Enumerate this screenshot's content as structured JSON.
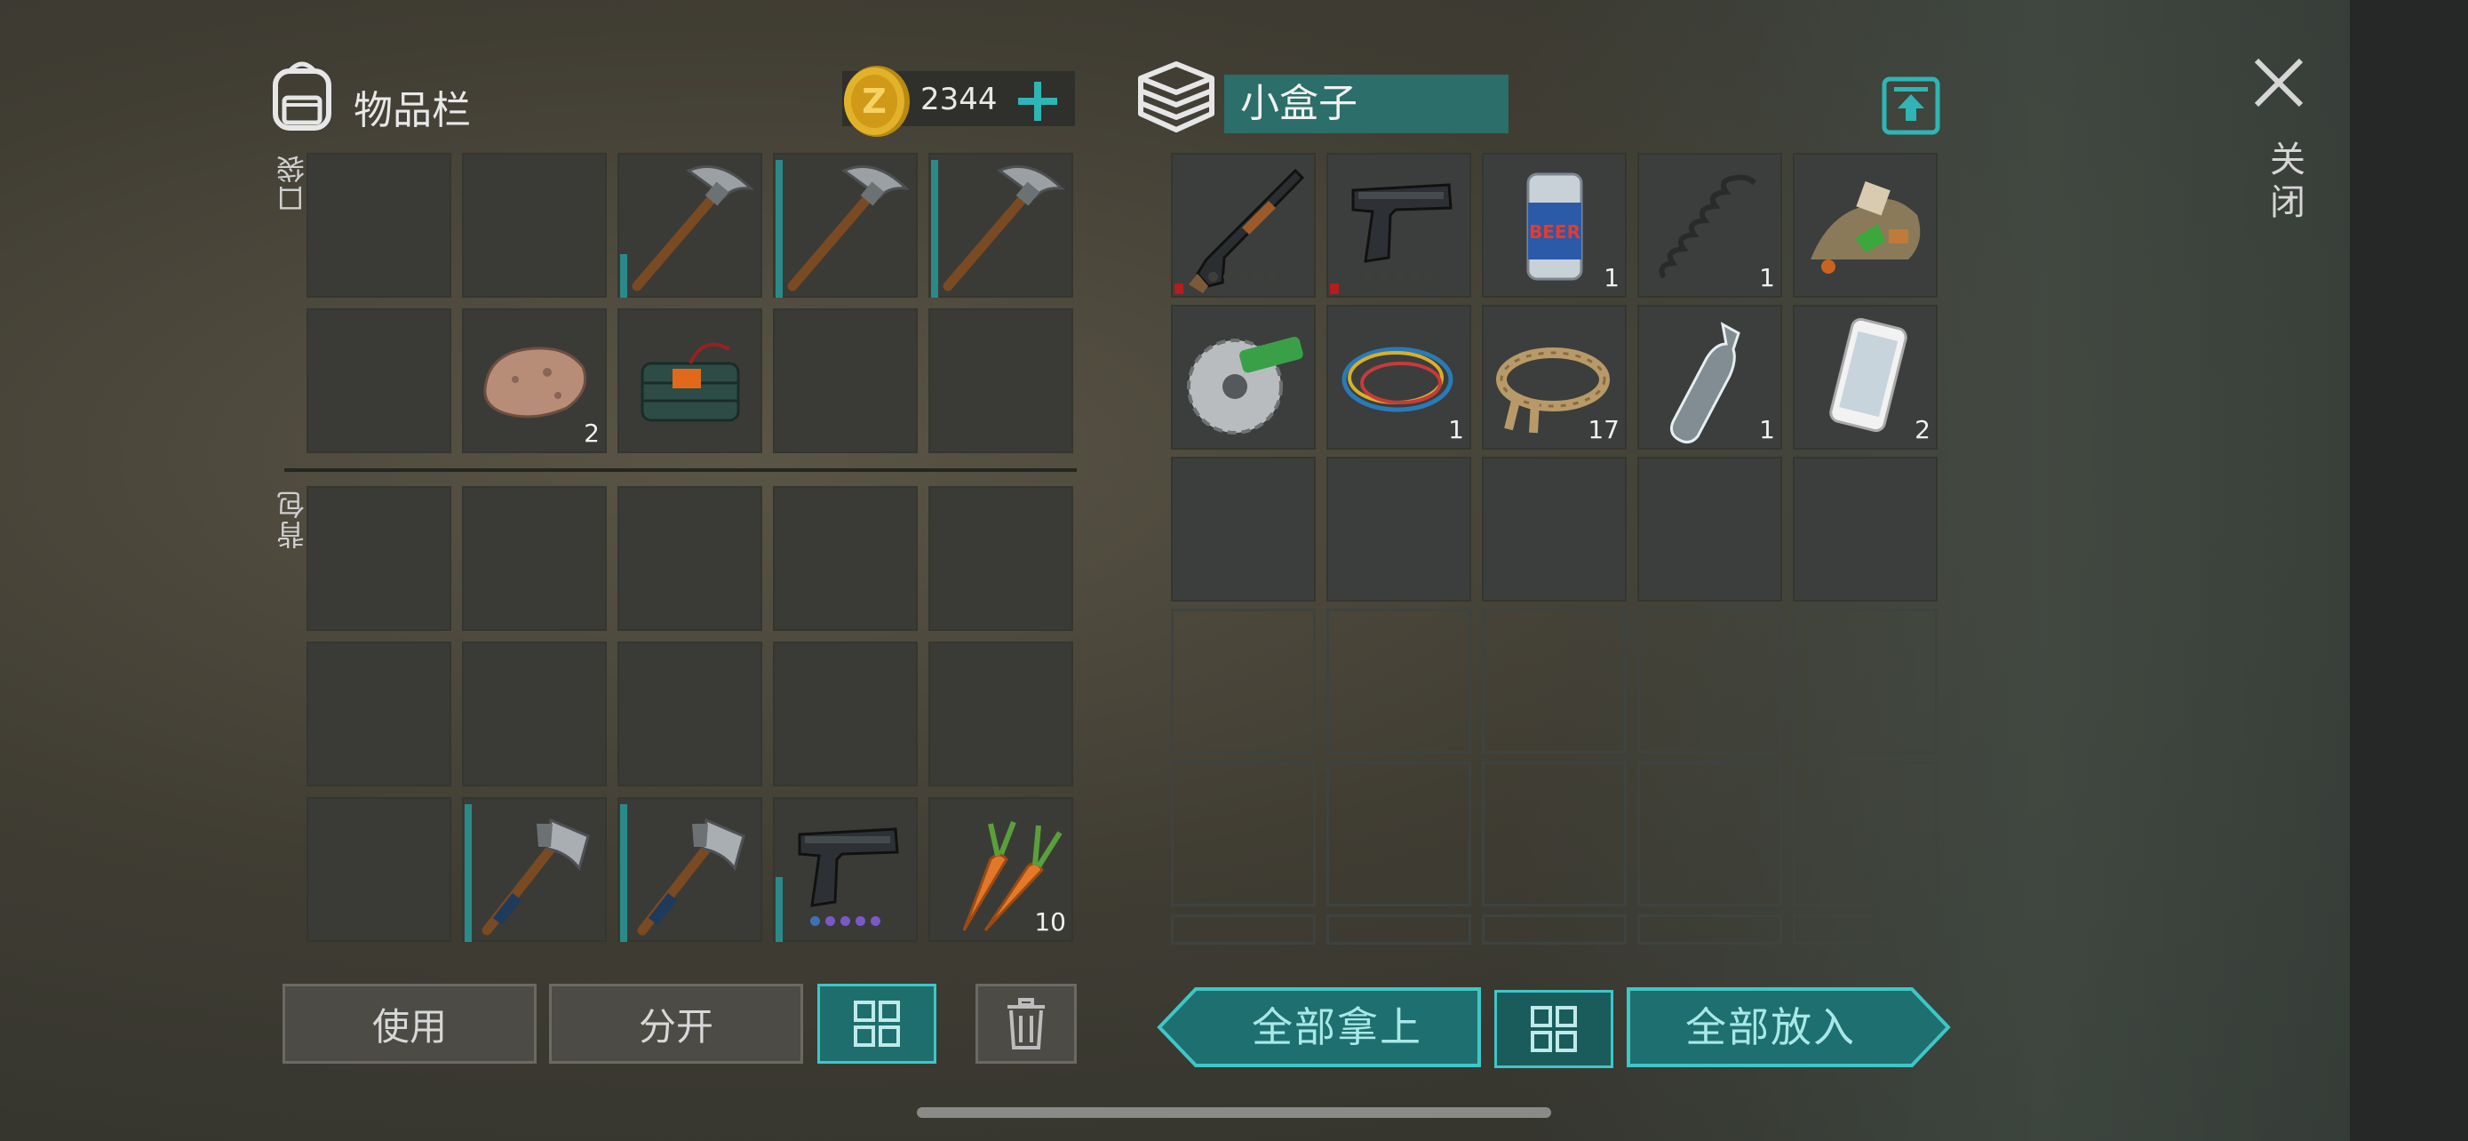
{
  "inventory": {
    "title": "物品栏",
    "coins": "2344",
    "pocket_label": "口袋",
    "backpack_label": "背包",
    "pocket_rows": [
      [
        {
          "item": ""
        },
        {
          "item": ""
        },
        {
          "item": "pickaxe-icon",
          "durability": 0.3
        },
        {
          "item": "pickaxe-icon",
          "durability": 0.95
        },
        {
          "item": "pickaxe-icon",
          "durability": 0.95
        }
      ],
      [
        {
          "item": ""
        },
        {
          "item": "stone-icon",
          "count": "2"
        },
        {
          "item": "explosive-icon"
        },
        {
          "item": ""
        },
        {
          "item": ""
        }
      ]
    ],
    "backpack_rows": [
      [
        {
          "item": ""
        },
        {
          "item": ""
        },
        {
          "item": ""
        },
        {
          "item": ""
        },
        {
          "item": ""
        }
      ],
      [
        {
          "item": ""
        },
        {
          "item": ""
        },
        {
          "item": ""
        },
        {
          "item": ""
        },
        {
          "item": ""
        }
      ],
      [
        {
          "item": ""
        },
        {
          "item": "hatchet-icon",
          "durability": 0.95
        },
        {
          "item": "hatchet-icon",
          "durability": 0.95
        },
        {
          "item": "pistol-icon",
          "durability": 0.45,
          "ammo": "purple"
        },
        {
          "item": "carrot-icon",
          "count": "10"
        }
      ]
    ]
  },
  "container": {
    "name": "小盒子",
    "rows": [
      [
        {
          "item": "shotgun-icon",
          "red": true,
          "ammo": "gray"
        },
        {
          "item": "pistol-icon",
          "red": true,
          "ammo": "gray"
        },
        {
          "item": "beer-can-icon",
          "count": "1"
        },
        {
          "item": "spring-icon",
          "count": "1"
        },
        {
          "item": "scrap-pile-icon"
        }
      ],
      [
        {
          "item": "saw-blade-icon"
        },
        {
          "item": "wires-icon",
          "count": "1"
        },
        {
          "item": "rope-icon",
          "count": "17"
        },
        {
          "item": "bottle-icon",
          "count": "1"
        },
        {
          "item": "phone-icon",
          "count": "2"
        }
      ],
      [
        {
          "item": ""
        },
        {
          "item": ""
        },
        {
          "item": ""
        },
        {
          "item": ""
        },
        {
          "item": ""
        }
      ]
    ]
  },
  "buttons": {
    "use": "使用",
    "split": "分开",
    "take_all": "全部拿上",
    "put_all": "全部放入"
  },
  "close_label": "关闭",
  "colors": {
    "accent": "#3ec7c7",
    "accent_dark": "#1f6e6e",
    "durability": "#2a8a8a"
  }
}
